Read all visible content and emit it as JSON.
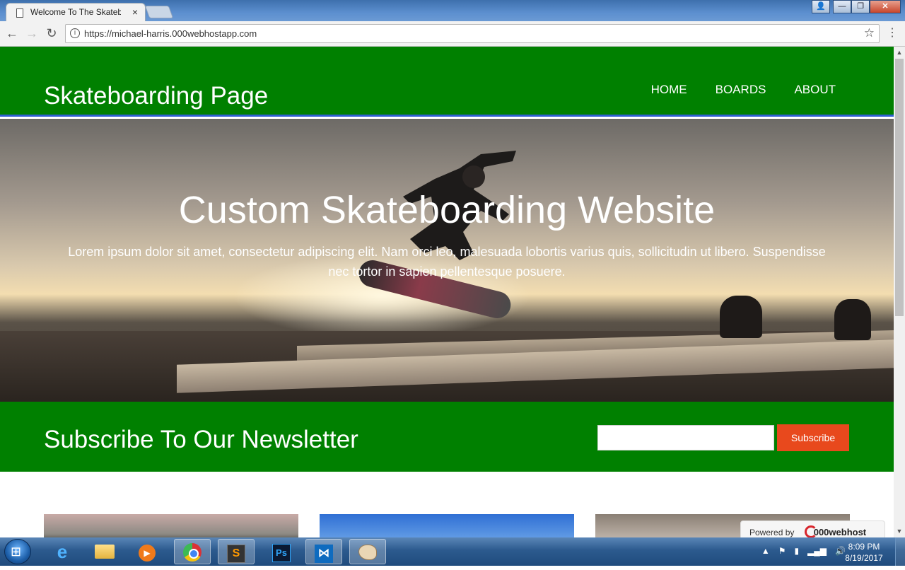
{
  "browser": {
    "tab_title": "Welcome To The Skateboarding Page",
    "tab_close": "×",
    "url": "https://michael-harris.000webhostapp.com",
    "back": "←",
    "forward": "→",
    "reload": "↻",
    "info": "i",
    "star": "☆",
    "menu": "⋮",
    "window_buttons": {
      "user": "👤",
      "minimize": "—",
      "maximize": "❐",
      "close": "✕"
    }
  },
  "site": {
    "logo": "Skateboarding Page",
    "nav": [
      "HOME",
      "BOARDS",
      "ABOUT"
    ],
    "hero": {
      "title": "Custom Skateboarding Website",
      "text": "Lorem ipsum dolor sit amet, consectetur adipiscing elit. Nam orci leo, malesuada lobortis varius quis, sollicitudin ut libero. Suspendisse nec tortor in sapien pellentesque posuere."
    },
    "newsletter": {
      "title": "Subscribe To Our Newsletter",
      "input_value": "",
      "button": "Subscribe"
    },
    "powered_by": {
      "label": "Powered by",
      "brand": "000webhost"
    },
    "colors": {
      "header_green": "#008000",
      "accent_blue": "#2f5fd0",
      "subscribe_orange": "#e8491d"
    }
  },
  "scrollbar": {
    "up": "▲",
    "down": "▼"
  },
  "taskbar": {
    "start": "⊞",
    "ie": "e",
    "media": "▶",
    "sublime": "S",
    "photoshop": "Ps",
    "vscode": "⋈",
    "tray": {
      "arrow": "▲",
      "flag": "⚑",
      "battery": "▮",
      "signal": "▂▄▆",
      "volume": "🔊"
    },
    "clock": {
      "time": "8:09 PM",
      "date": "8/19/2017"
    }
  }
}
